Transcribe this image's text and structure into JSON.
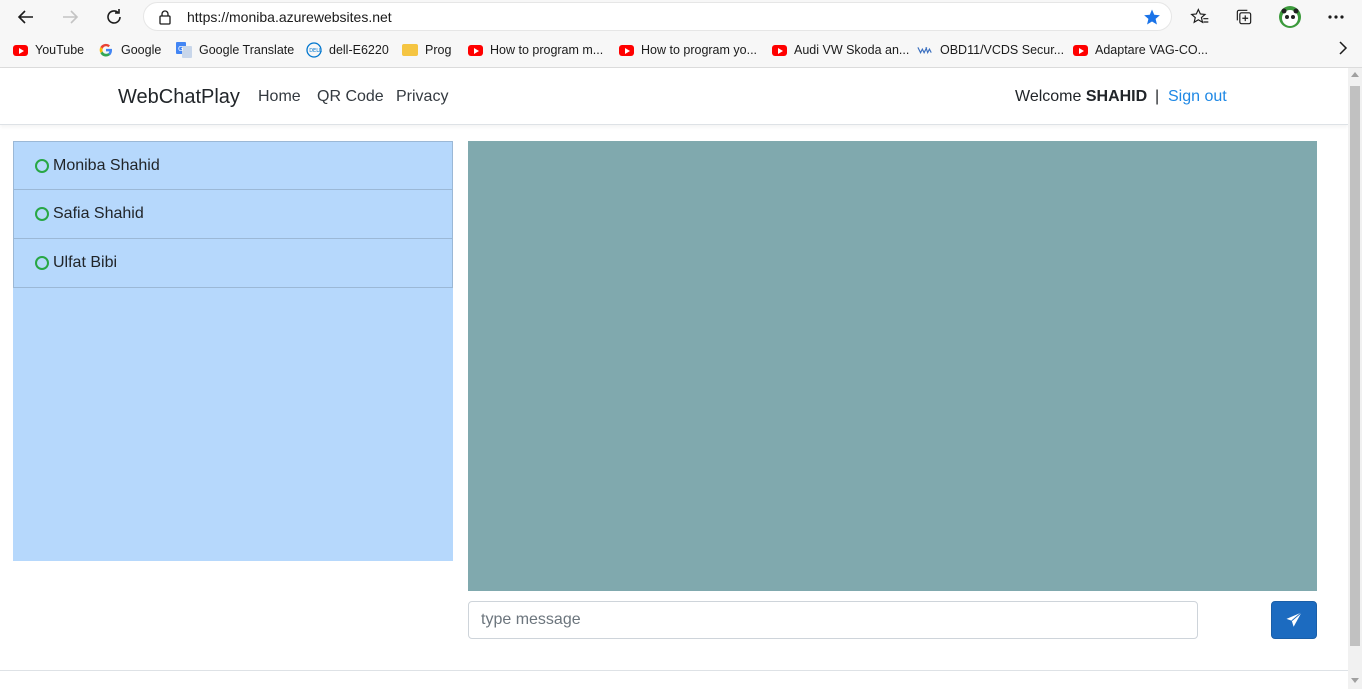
{
  "browser": {
    "url": "https://moniba.azurewebsites.net",
    "bookmarks": [
      {
        "label": "YouTube",
        "icon": "youtube-icon"
      },
      {
        "label": "Google",
        "icon": "google-icon"
      },
      {
        "label": "Google Translate",
        "icon": "google-translate-icon"
      },
      {
        "label": "dell-E6220",
        "icon": "dell-icon"
      },
      {
        "label": "Prog",
        "icon": "folder-icon"
      },
      {
        "label": "How to program m...",
        "icon": "youtube-icon"
      },
      {
        "label": "How to program yo...",
        "icon": "youtube-icon"
      },
      {
        "label": "Audi VW Skoda an...",
        "icon": "youtube-icon"
      },
      {
        "label": "OBD11/VCDS Secur...",
        "icon": "vw-icon"
      },
      {
        "label": "Adaptare VAG-CO...",
        "icon": "youtube-icon"
      }
    ]
  },
  "navbar": {
    "brand": "WebChatPlay",
    "links": [
      "Home",
      "QR Code",
      "Privacy"
    ],
    "welcome_prefix": "Welcome",
    "username": "SHAHID",
    "separator": "|",
    "signout": "Sign out"
  },
  "users": [
    {
      "name": "Moniba Shahid",
      "status": "online"
    },
    {
      "name": "Safia Shahid",
      "status": "online"
    },
    {
      "name": "Ulfat Bibi",
      "status": "online"
    }
  ],
  "chat": {
    "placeholder": "type message",
    "send_icon": "paper-plane-icon"
  },
  "colors": {
    "users_panel_bg": "#b6d8fc",
    "chat_area_bg": "#80a9ae",
    "send_button": "#1c6bc0",
    "status_ring": "#28a745",
    "signout_link": "#1e88e5"
  }
}
